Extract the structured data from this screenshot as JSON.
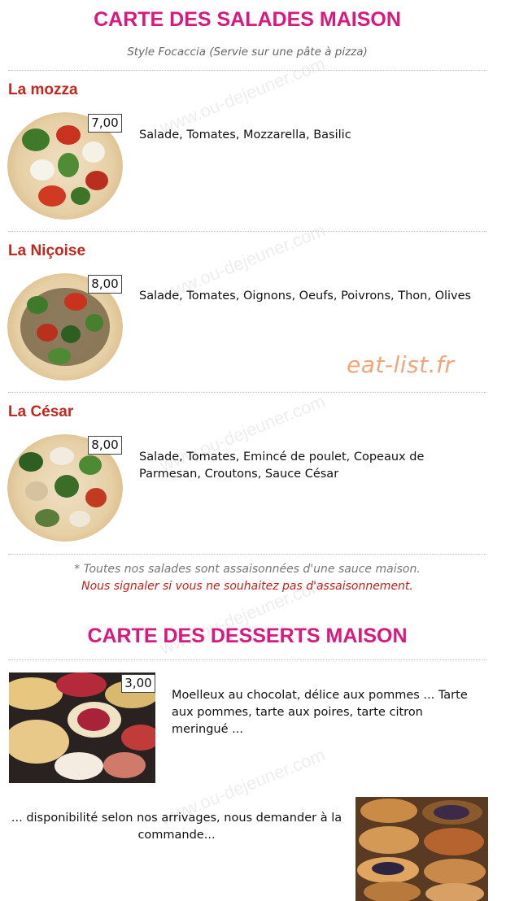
{
  "salads": {
    "title": "CARTE DES SALADES MAISON",
    "subtitle": "Style Focaccia (Servie sur une pâte à pizza)",
    "items": [
      {
        "name": "La mozza",
        "price": "7,00",
        "description": "Salade, Tomates, Mozzarella, Basilic"
      },
      {
        "name": "La Niçoise",
        "price": "8,00",
        "description": "Salade, Tomates, Oignons, Oeufs, Poivrons, Thon, Olives"
      },
      {
        "name": "La César",
        "price": "8,00",
        "description": "Salade, Tomates, Emincé de poulet, Copeaux de Parmesan, Croutons, Sauce César"
      }
    ],
    "note": "* Toutes nos salades sont assaisonnées d'une sauce maison.",
    "note_warning": "Nous signaler si vous ne souhaitez pas d'assaisonnement."
  },
  "desserts": {
    "title": "CARTE DES DESSERTS MAISON",
    "price": "3,00",
    "description": "Moelleux au chocolat, délice aux pommes ... Tarte aux pommes, tarte aux poires, tarte citron meringué ...",
    "availability": "... disponibilité selon nos arrivages, nous demander à la commande..."
  },
  "watermark": "www.ou-dejeuner.com",
  "brand_watermark": "eat-list.fr",
  "colors": {
    "title": "#d8197e",
    "item_name": "#c6261d",
    "warning": "#c0201c",
    "brand": "#f0a57a"
  }
}
